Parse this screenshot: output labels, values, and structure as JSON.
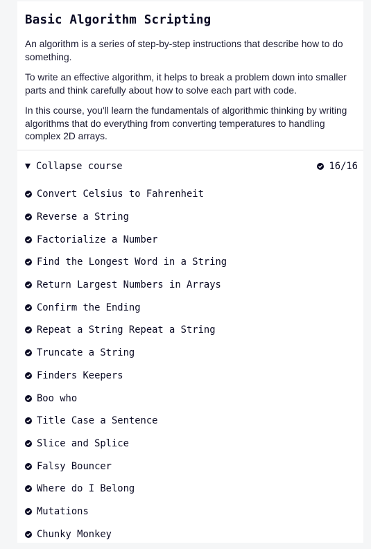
{
  "block": {
    "title": "Basic Algorithm Scripting",
    "intro": [
      "An algorithm is a series of step-by-step instructions that describe how to do something.",
      "To write an effective algorithm, it helps to break a problem down into smaller parts and think carefully about how to solve each part with code.",
      "In this course, you'll learn the fundamentals of algorithmic thinking by writing algorithms that do everything from converting temperatures to handling complex 2D arrays."
    ]
  },
  "collapse": {
    "label": "Collapse course",
    "progress": "16/16",
    "completed": 16,
    "total": 16
  },
  "icons": {
    "completed": "check-circle-icon",
    "toggle": "caret-down-icon"
  },
  "lessons": [
    "Convert Celsius to Fahrenheit",
    "Reverse a String",
    "Factorialize a Number",
    "Find the Longest Word in a String",
    "Return Largest Numbers in Arrays",
    "Confirm the Ending",
    "Repeat a String Repeat a String",
    "Truncate a String",
    "Finders Keepers",
    "Boo who",
    "Title Case a Sentence",
    "Slice and Splice",
    "Falsy Bouncer",
    "Where do I Belong",
    "Mutations",
    "Chunky Monkey"
  ],
  "colors": {
    "text": "#0a0a23",
    "background": "#f5f6f7",
    "card": "#ffffff"
  }
}
